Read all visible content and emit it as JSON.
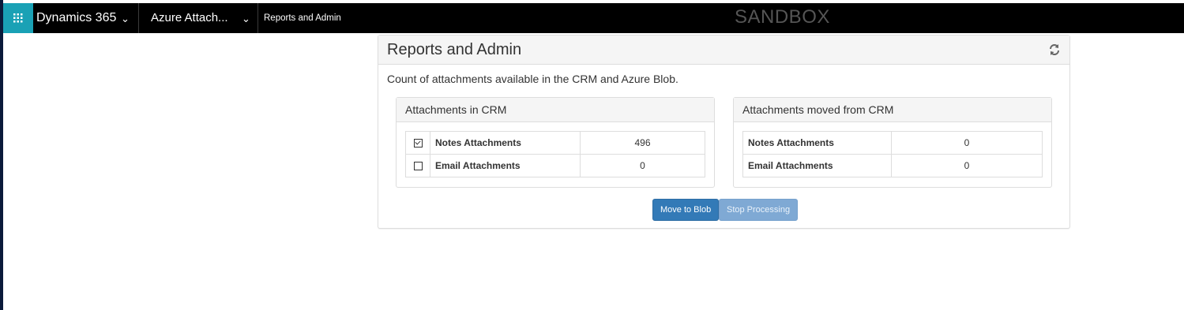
{
  "navbar": {
    "app_name": "Dynamics 365",
    "area_name": "Azure Attach...",
    "breadcrumb": "Reports and Admin",
    "environment": "SANDBOX",
    "waffle_icon": "app-launcher-icon",
    "chevron_icon": "chevron-down-icon",
    "chevron_glyph": "⌄",
    "accent_color": "#1aa1b5"
  },
  "panel": {
    "title": "Reports and Admin",
    "refresh_icon": "refresh-icon",
    "description": "Count of attachments available in the CRM and Azure Blob."
  },
  "crm": {
    "title": "Attachments in CRM",
    "rows": [
      {
        "label": "Notes Attachments",
        "value": "496",
        "checked": true
      },
      {
        "label": "Email Attachments",
        "value": "0",
        "checked": false
      }
    ]
  },
  "moved": {
    "title": "Attachments moved from CRM",
    "rows": [
      {
        "label": "Notes Attachments",
        "value": "0"
      },
      {
        "label": "Email Attachments",
        "value": "0"
      }
    ]
  },
  "buttons": {
    "move_label": "Move to Blob",
    "stop_label": "Stop Processing"
  }
}
